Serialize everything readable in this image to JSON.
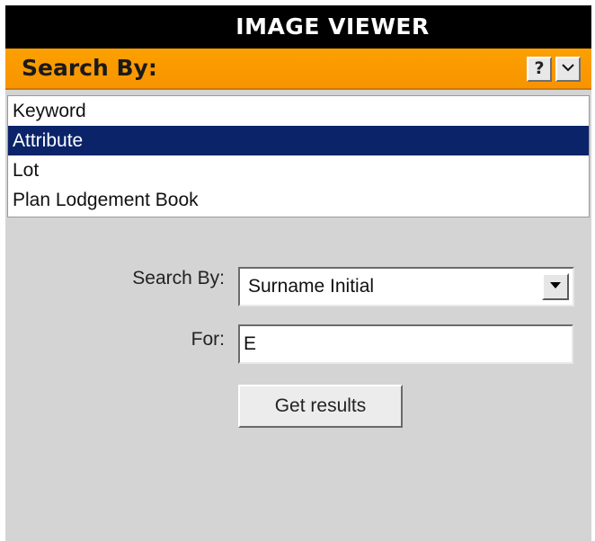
{
  "window": {
    "title": "IMAGE VIEWER"
  },
  "search_panel": {
    "header_label": "Search By:",
    "help_label": "?",
    "collapse_icon": "chevron-down-icon",
    "search_types": [
      {
        "label": "Keyword",
        "selected": false
      },
      {
        "label": "Attribute",
        "selected": true
      },
      {
        "label": "Lot",
        "selected": false
      },
      {
        "label": "Plan Lodgement Book",
        "selected": false
      }
    ]
  },
  "form": {
    "search_by_label": "Search By:",
    "search_by_value": "Surname Initial",
    "for_label": "For:",
    "for_value": "E",
    "submit_label": "Get results"
  },
  "colors": {
    "title_bar": "#000000",
    "header_accent": "#f79400",
    "selection": "#0a2369",
    "panel_background": "#d4d4d4"
  }
}
